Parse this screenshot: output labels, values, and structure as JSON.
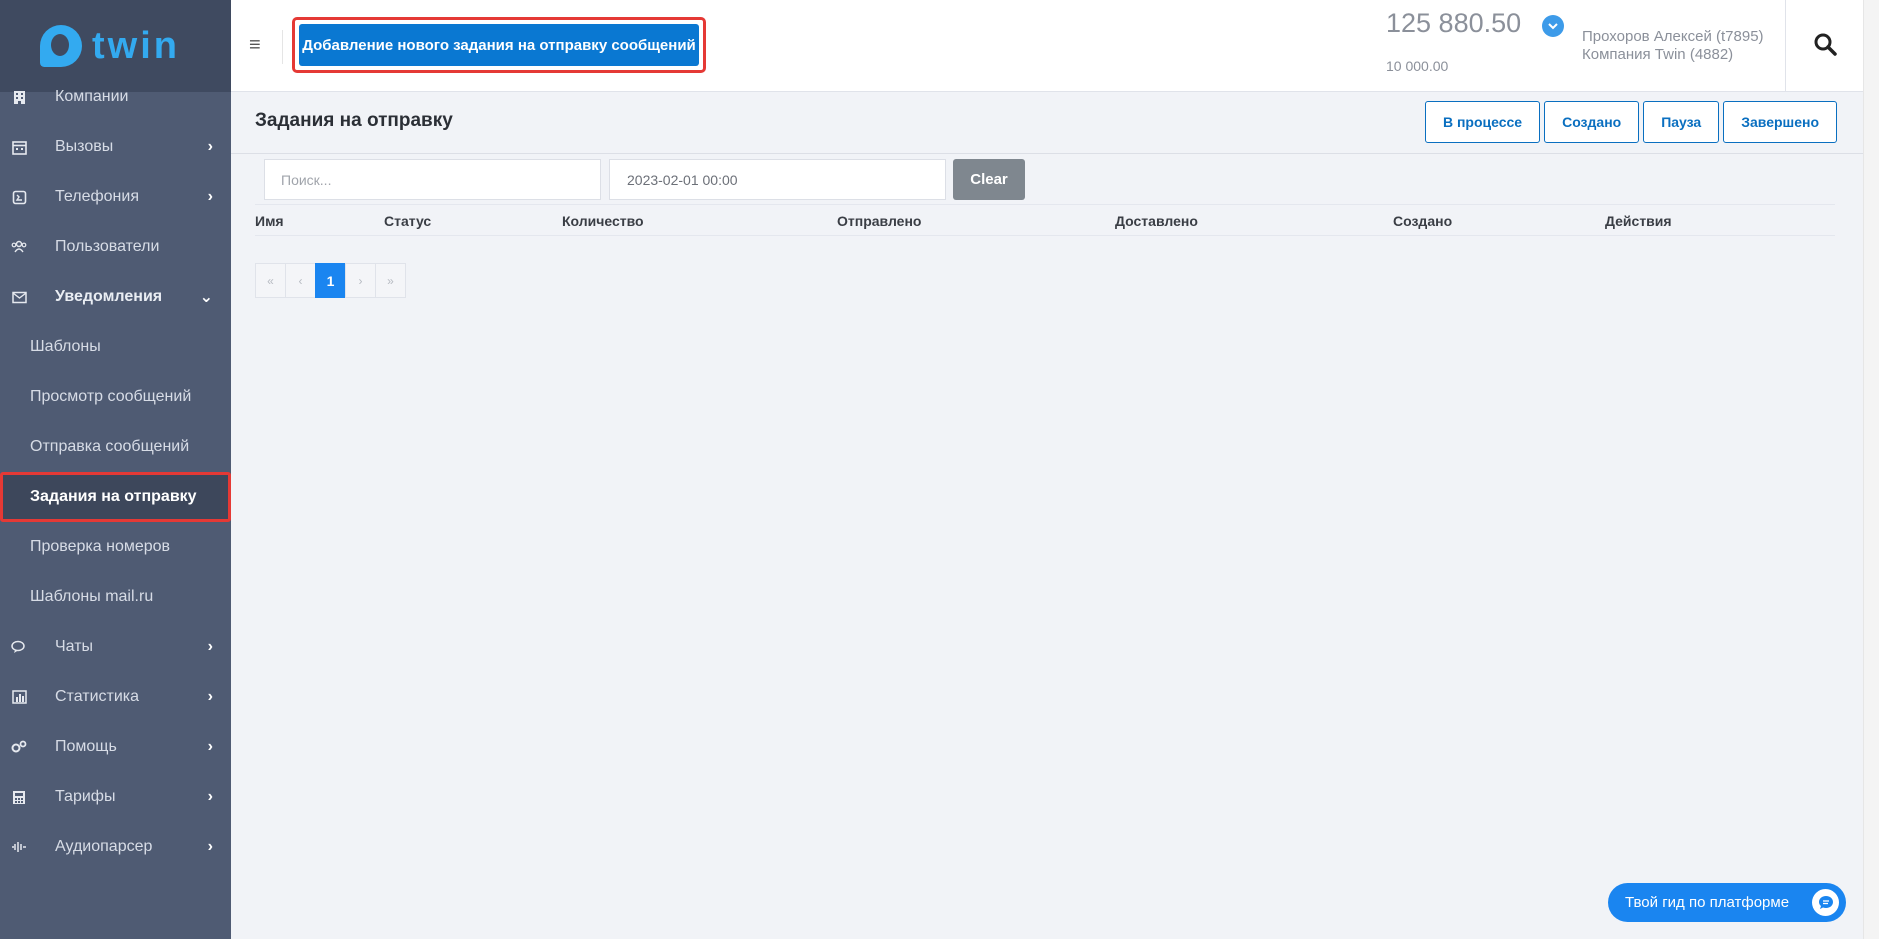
{
  "brand": {
    "name": "twin"
  },
  "sidebar": {
    "items": [
      {
        "label": "Компании",
        "icon": "building-icon"
      },
      {
        "label": "Вызовы",
        "icon": "calendar-icon"
      },
      {
        "label": "Телефония",
        "icon": "phone-icon"
      },
      {
        "label": "Пользователи",
        "icon": "users-icon"
      },
      {
        "label": "Уведомления",
        "icon": "envelope-icon"
      }
    ],
    "sub_items": [
      {
        "label": "Шаблоны"
      },
      {
        "label": "Просмотр сообщений"
      },
      {
        "label": "Отправка сообщений"
      },
      {
        "label": "Задания на отправку"
      },
      {
        "label": "Проверка номеров"
      },
      {
        "label": "Шаблоны mail.ru"
      }
    ],
    "items_after": [
      {
        "label": "Чаты",
        "icon": "chat-icon"
      },
      {
        "label": "Статистика",
        "icon": "chart-icon"
      },
      {
        "label": "Помощь",
        "icon": "gears-icon"
      },
      {
        "label": "Тарифы",
        "icon": "calculator-icon"
      },
      {
        "label": "Аудиопарсер",
        "icon": "waveform-icon"
      }
    ],
    "chevron": "›",
    "chevron_open": "⌄"
  },
  "header": {
    "menu_glyph": "≡",
    "add_button": "Добавление нового задания на отправку сообщений",
    "balance": "125 880.50",
    "credit": "10 000.00",
    "user_name": "Прохоров Алексей (t7895)",
    "company": "Компания Twin (4882)"
  },
  "main": {
    "title": "Задания на отправку",
    "filters": [
      "В процессе",
      "Создано",
      "Пауза",
      "Завершено"
    ],
    "search_placeholder": "Поиск...",
    "date_value": "2023-02-01 00:00",
    "clear_label": "Clear",
    "columns": [
      "Имя",
      "Статус",
      "Количество",
      "Отправлено",
      "Доставлено",
      "Создано",
      "Действия"
    ],
    "pagination": {
      "first": "«",
      "prev": "‹",
      "current": "1",
      "next": "›",
      "last": "»"
    }
  },
  "guide": {
    "label": "Твой гид по платформе"
  },
  "colors": {
    "accent": "#0a78d2",
    "sidebar": "#4f5b73",
    "highlight": "#e53935"
  }
}
